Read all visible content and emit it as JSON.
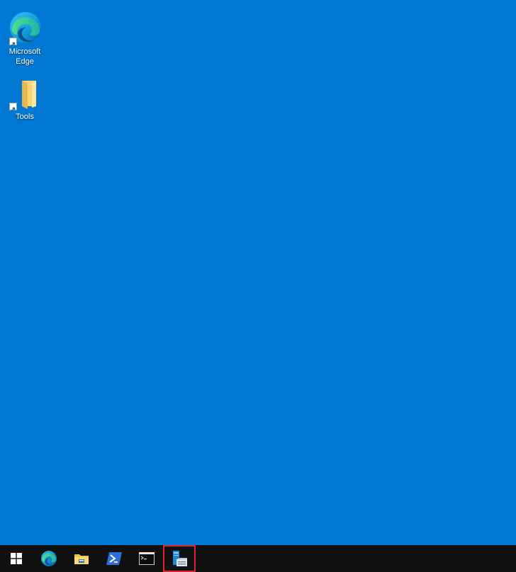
{
  "colors": {
    "desktop_background": "#0078d4",
    "taskbar_background": "#101010",
    "highlight_border": "#e0202a"
  },
  "desktop": {
    "icons": [
      {
        "label": "Microsoft\nEdge",
        "icon": "edge-icon"
      },
      {
        "label": "Tools",
        "icon": "folder-icon"
      }
    ]
  },
  "taskbar": {
    "items": [
      {
        "name": "start",
        "icon": "windows-logo-icon"
      },
      {
        "name": "edge",
        "icon": "edge-icon"
      },
      {
        "name": "file-explorer",
        "icon": "file-explorer-icon"
      },
      {
        "name": "powershell",
        "icon": "powershell-icon"
      },
      {
        "name": "command-prompt",
        "icon": "command-prompt-icon"
      },
      {
        "name": "server-manager",
        "icon": "server-manager-icon",
        "highlighted": true
      }
    ]
  }
}
